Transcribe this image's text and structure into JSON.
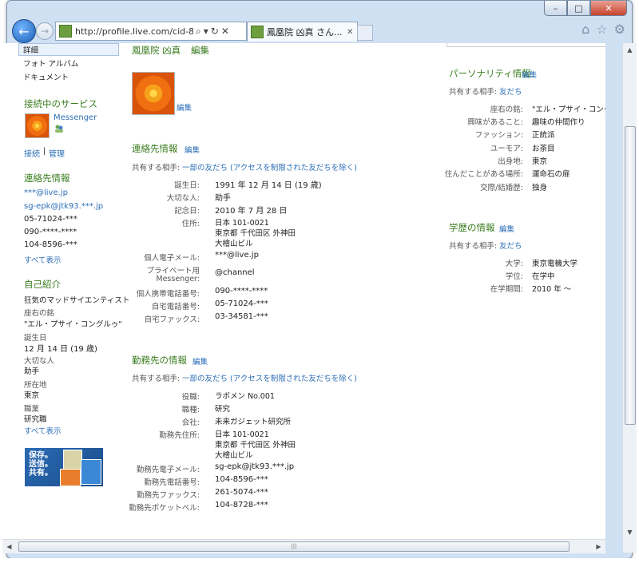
{
  "browser": {
    "url": "http://profile.live.com/cid-8al",
    "tab_title": "鳳凰院 凶真 さん...",
    "hscroll_grip": "|||"
  },
  "left": {
    "nav": [
      "詳細",
      "フォト アルバム",
      "ドキュメント"
    ],
    "connected_title": "接続中のサービス",
    "messenger": "Messenger",
    "connect": "接続",
    "sep": "|",
    "manage": "管理",
    "contact_title": "連絡先情報",
    "contacts": [
      "***@live.jp",
      "sg-epk@jtk93.***.jp"
    ],
    "phones": [
      "05-71024-***",
      "090-****-****",
      "104-8596-***"
    ],
    "show_all_1": "すべて表示",
    "intro_title": "自己紹介",
    "intro_text": "狂気のマッドサイエンティスト",
    "fields": [
      {
        "label": "座右の銘",
        "value": "\"エル・プサイ・コングルゥ\""
      },
      {
        "label": "誕生日",
        "value": "12 月 14 日 (19 歳)"
      },
      {
        "label": "大切な人",
        "value": "助手"
      },
      {
        "label": "所在地",
        "value": "東京"
      },
      {
        "label": "職業",
        "value": "研究職"
      }
    ],
    "show_all_2": "すべて表示",
    "banner_text": [
      "保存。",
      "送信。",
      "共有。"
    ]
  },
  "main": {
    "name": "鳳凰院 凶真",
    "edit": "編集",
    "photo_edit": "編集",
    "contact": {
      "title": "連絡先情報",
      "edit": "編集",
      "share_label": "共有する相手:",
      "share_value": "一部の友だち (アクセスを制限された友だちを除く)",
      "rows": [
        {
          "label": "誕生日:",
          "value": "1991 年 12 月 14 日 (19 歳)"
        },
        {
          "label": "大切な人:",
          "value": "助手"
        },
        {
          "label": "記念日:",
          "value": "2010 年 7 月 28 日"
        },
        {
          "label": "住所:",
          "value": "日本 101-0021",
          "value2": "東京都 千代田区 外神田",
          "value3": "大檜山ビル"
        },
        {
          "label": "個人電子メール:",
          "value": "***@live.jp"
        },
        {
          "label": "プライベート用",
          "label2": "Messenger:",
          "value": "@channel"
        },
        {
          "label": "個人携帯電話番号:",
          "value": "090-****-****"
        },
        {
          "label": "自宅電話番号:",
          "value": "05-71024-***"
        },
        {
          "label": "自宅ファックス:",
          "value": "03-34581-***"
        }
      ]
    },
    "work": {
      "title": "勤務先の情報",
      "edit": "編集",
      "share_label": "共有する相手:",
      "share_value": "一部の友だち (アクセスを制限された友だちを除く)",
      "rows": [
        {
          "label": "役職:",
          "value": "ラボメン No.001"
        },
        {
          "label": "職種:",
          "value": "研究"
        },
        {
          "label": "会社:",
          "value": "未来ガジェット研究所"
        },
        {
          "label": "勤務先住所:",
          "value": "日本 101-0021",
          "value2": "東京都 千代田区 外神田",
          "value3": "大檜山ビル"
        },
        {
          "label": "勤務先電子メール:",
          "value": "sg-epk@jtk93.***.jp"
        },
        {
          "label": "勤務先電話番号:",
          "value": "104-8596-***"
        },
        {
          "label": "勤務先ファックス:",
          "value": "261-5074-***"
        },
        {
          "label": "勤務先ポケットベル:",
          "value": "104-8728-***"
        }
      ]
    }
  },
  "right": {
    "personality": {
      "title": "パーソナリティ情報",
      "edit": "編集",
      "share_label": "共有する相手:",
      "share_value": "友だち",
      "rows": [
        {
          "label": "座右の銘:",
          "value": "\"エル・プサイ・コングルゥ\""
        },
        {
          "label": "興味があること:",
          "value": "趣味の仲間作り"
        },
        {
          "label": "ファッション:",
          "value": "正統派"
        },
        {
          "label": "ユーモア:",
          "value": "お茶目"
        },
        {
          "label": "出身地:",
          "value": "東京"
        },
        {
          "label": "住んだことがある場所:",
          "value": "運命石の扉"
        },
        {
          "label": "交際/結婚歴:",
          "value": "独身"
        }
      ]
    },
    "education": {
      "title": "学歴の情報",
      "edit": "編集",
      "share_label": "共有する相手:",
      "share_value": "友だち",
      "rows": [
        {
          "label": "大学:",
          "value": "東京電機大学"
        },
        {
          "label": "学位:",
          "value": "在学中"
        },
        {
          "label": "在学期間:",
          "value": "2010 年 ～"
        }
      ]
    }
  }
}
